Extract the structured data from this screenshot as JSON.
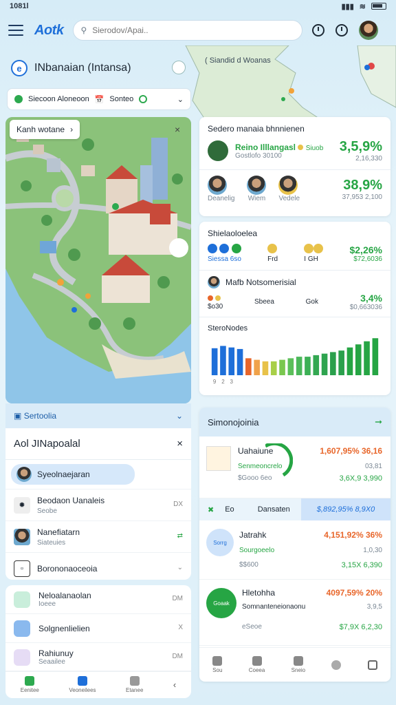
{
  "status": {
    "left": "1081l",
    "time_icon": "wifi-icon"
  },
  "topbar": {
    "logo": "Aotk",
    "search_placeholder": "Sierodov/Apai.."
  },
  "map_header": {
    "title": "INbanaian (Intansa)",
    "label": "( Siandid d Woanas"
  },
  "filter": {
    "item1": "Siecoon Aloneoon",
    "item2": "Sonteo"
  },
  "map": {
    "tag": "Kanh wotane",
    "close": "×"
  },
  "left_panel": {
    "header": "Sertoolia",
    "title": "Aol JINapoalal",
    "selected": "Syeolnaejaran",
    "rows": [
      {
        "title": "Beodaon Uanaleis",
        "sub": "Seobe",
        "end": "DX"
      },
      {
        "title": "Nanefiatarn",
        "sub": "Siateuies",
        "end": ""
      },
      {
        "title": "Borononaoceoia",
        "sub": "",
        "end": ""
      }
    ]
  },
  "left_panel2": {
    "rows": [
      {
        "title": "Neloalanaolan",
        "sub": "Ioeee",
        "end": "DM"
      },
      {
        "title": "Solgnenlielien",
        "sub": "",
        "end": "X"
      },
      {
        "title": "Rahiunuy",
        "sub": "Seaailee",
        "end": "DM"
      }
    ],
    "tabs": [
      "Eenitee",
      "Veoneilees",
      "Etanee",
      ""
    ]
  },
  "card1": {
    "title": "Sedero manaia bhnnienen",
    "row1": {
      "name": "Reino Illlangasl",
      "tag": "Siuob",
      "sub": "Gostlofo 30100",
      "pct": "3,5,9%",
      "val": "2,16,330"
    },
    "avatars": [
      "Deanelig",
      "Wiem",
      "Vedele"
    ],
    "row2": {
      "pct": "38,9%",
      "val": "37,953 2,100"
    }
  },
  "card2": {
    "title": "Shielaoloelea",
    "row1": {
      "a": "Siessa 6so",
      "b": "Frd",
      "c": "I GH",
      "pct": "$2,26%",
      "val": "$72,6036"
    },
    "title2": "Mafb Notsomerisial",
    "row2": {
      "a": "$o30",
      "b": "Sbeea",
      "c": "Gok",
      "pct": "3,4%",
      "val": "$0,663036"
    },
    "chart_title": "SteroNodes"
  },
  "chart_data": {
    "type": "bar",
    "title": "SteroNodes",
    "categories": [
      "9",
      "2",
      "3",
      "",
      "",
      "",
      "",
      "",
      "",
      "",
      "",
      "",
      "",
      "",
      "",
      "",
      "",
      "",
      "",
      ""
    ],
    "values": [
      35,
      38,
      36,
      34,
      22,
      20,
      18,
      18,
      20,
      22,
      24,
      24,
      26,
      28,
      30,
      32,
      36,
      40,
      44,
      48
    ],
    "colors": [
      "#1e6fd9",
      "#1e6fd9",
      "#1e6fd9",
      "#1e6fd9",
      "#e8662a",
      "#f0a24a",
      "#e8c24a",
      "#a8cf48",
      "#7ac74f",
      "#5cbf5a",
      "#4cb85a",
      "#3cb055",
      "#34a852",
      "#2ea44f",
      "#2aa04c",
      "#2aa04c",
      "#26a544",
      "#26a544",
      "#26a544",
      "#26a544"
    ],
    "ylim": [
      0,
      50
    ]
  },
  "card3": {
    "title": "Simonojoinia",
    "rows": [
      {
        "title": "Uahaiune",
        "sub": "Senmeoncrelo",
        "sub2": "$Gooo 6eo",
        "pct": "1,607,95% 36,16",
        "v1": "03,81",
        "v2": "3,6X,9 3,990"
      },
      {
        "title": "Jatrahk",
        "sub": "Sourgoeelo",
        "sub2": "$$600",
        "pct": "4,151,92% 36%",
        "v1": "1,0,30",
        "v2": "3,15X 6,390",
        "badge": "Sorrg"
      },
      {
        "title": "Hletohha",
        "sub": "Somnanteneionaonu",
        "sub2": "eSeoe",
        "pct": "4097,59% 20%",
        "v1": "3,9,5",
        "v2": "$7,9X 6,2,30",
        "badge": "Goaak"
      }
    ],
    "band": {
      "a": "Eo",
      "b": "Dansaten",
      "hl": "$,892,95% 8,9X0"
    },
    "tabs": [
      "Sou",
      "Coeea",
      "Sneio",
      "",
      ""
    ]
  }
}
